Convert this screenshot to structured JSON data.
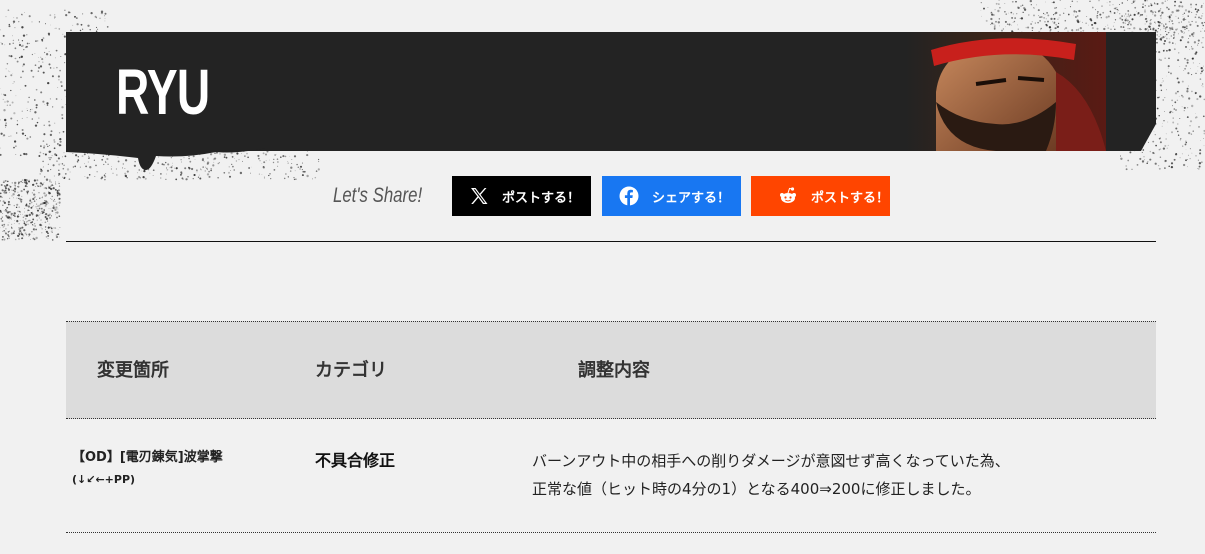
{
  "page": {
    "character_name": "RYU",
    "portrait_alt": "ryu-portrait"
  },
  "share": {
    "label": "Let's Share!",
    "buttons": [
      {
        "id": "x",
        "label": "ポストする！",
        "icon": "x-logo-icon",
        "color": "#000000"
      },
      {
        "id": "facebook",
        "label": "シェアする！",
        "icon": "facebook-icon",
        "color": "#1877f2"
      },
      {
        "id": "reddit",
        "label": "ポストする！",
        "icon": "reddit-icon",
        "color": "#ff4500"
      }
    ]
  },
  "table": {
    "headers": [
      "変更箇所",
      "カテゴリ",
      "調整内容"
    ],
    "rows": [
      {
        "move": "【OD】[電刃錬気]波掌撃",
        "command": "(↓↙←+PP)",
        "category": "不具合修正",
        "detail_line1": "バーンアウト中の相手への削りダメージが意図せず高くなっていた為、",
        "detail_line2": "正常な値（ヒット時の4分の1）となる400⇒200に修正しました。"
      }
    ]
  }
}
